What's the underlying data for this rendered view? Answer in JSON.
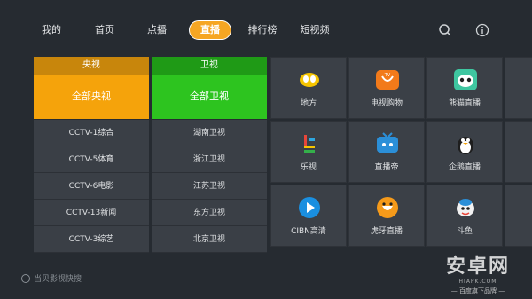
{
  "nav": {
    "items": [
      "我的",
      "首页",
      "点播",
      "直播",
      "排行榜",
      "短视频"
    ],
    "active_index": 3,
    "search_icon": "search-icon",
    "info_icon": "info-icon"
  },
  "columns": [
    {
      "header": "央视",
      "feature": "全部央视",
      "rows": [
        "CCTV-1综合",
        "CCTV-5体育",
        "CCTV-6电影",
        "CCTV-13新闻",
        "CCTV-3综艺"
      ]
    },
    {
      "header": "卫视",
      "feature": "全部卫视",
      "rows": [
        "湖南卫视",
        "浙江卫视",
        "江苏卫视",
        "东方卫视",
        "北京卫视"
      ]
    }
  ],
  "apps": [
    {
      "label": "地方",
      "icon": "local-icon",
      "color": "#f5c400"
    },
    {
      "label": "电视购物",
      "icon": "tv-shopping-icon",
      "color": "#f27a1a"
    },
    {
      "label": "熊猫直播",
      "icon": "panda-icon",
      "color": "#3ec6a0"
    },
    {
      "label": "乐视",
      "icon": "letv-icon",
      "color": "#3b4047"
    },
    {
      "label": "直播帝",
      "icon": "tv-icon",
      "color": "#2b8fd8"
    },
    {
      "label": "企鹅直播",
      "icon": "penguin-icon",
      "color": "#ffffff"
    },
    {
      "label": "CIBN高清",
      "icon": "play-icon",
      "color": "#1a8fe0"
    },
    {
      "label": "虎牙直播",
      "icon": "huya-icon",
      "color": "#f59a1a"
    },
    {
      "label": "斗鱼",
      "icon": "douyu-icon",
      "color": "#ffffff"
    }
  ],
  "bottom": {
    "hint": "当贝影视快搜"
  },
  "watermark": {
    "title": "安卓网",
    "url": "HIAPK.COM",
    "sub": "— 百度旗下品牌 —"
  }
}
